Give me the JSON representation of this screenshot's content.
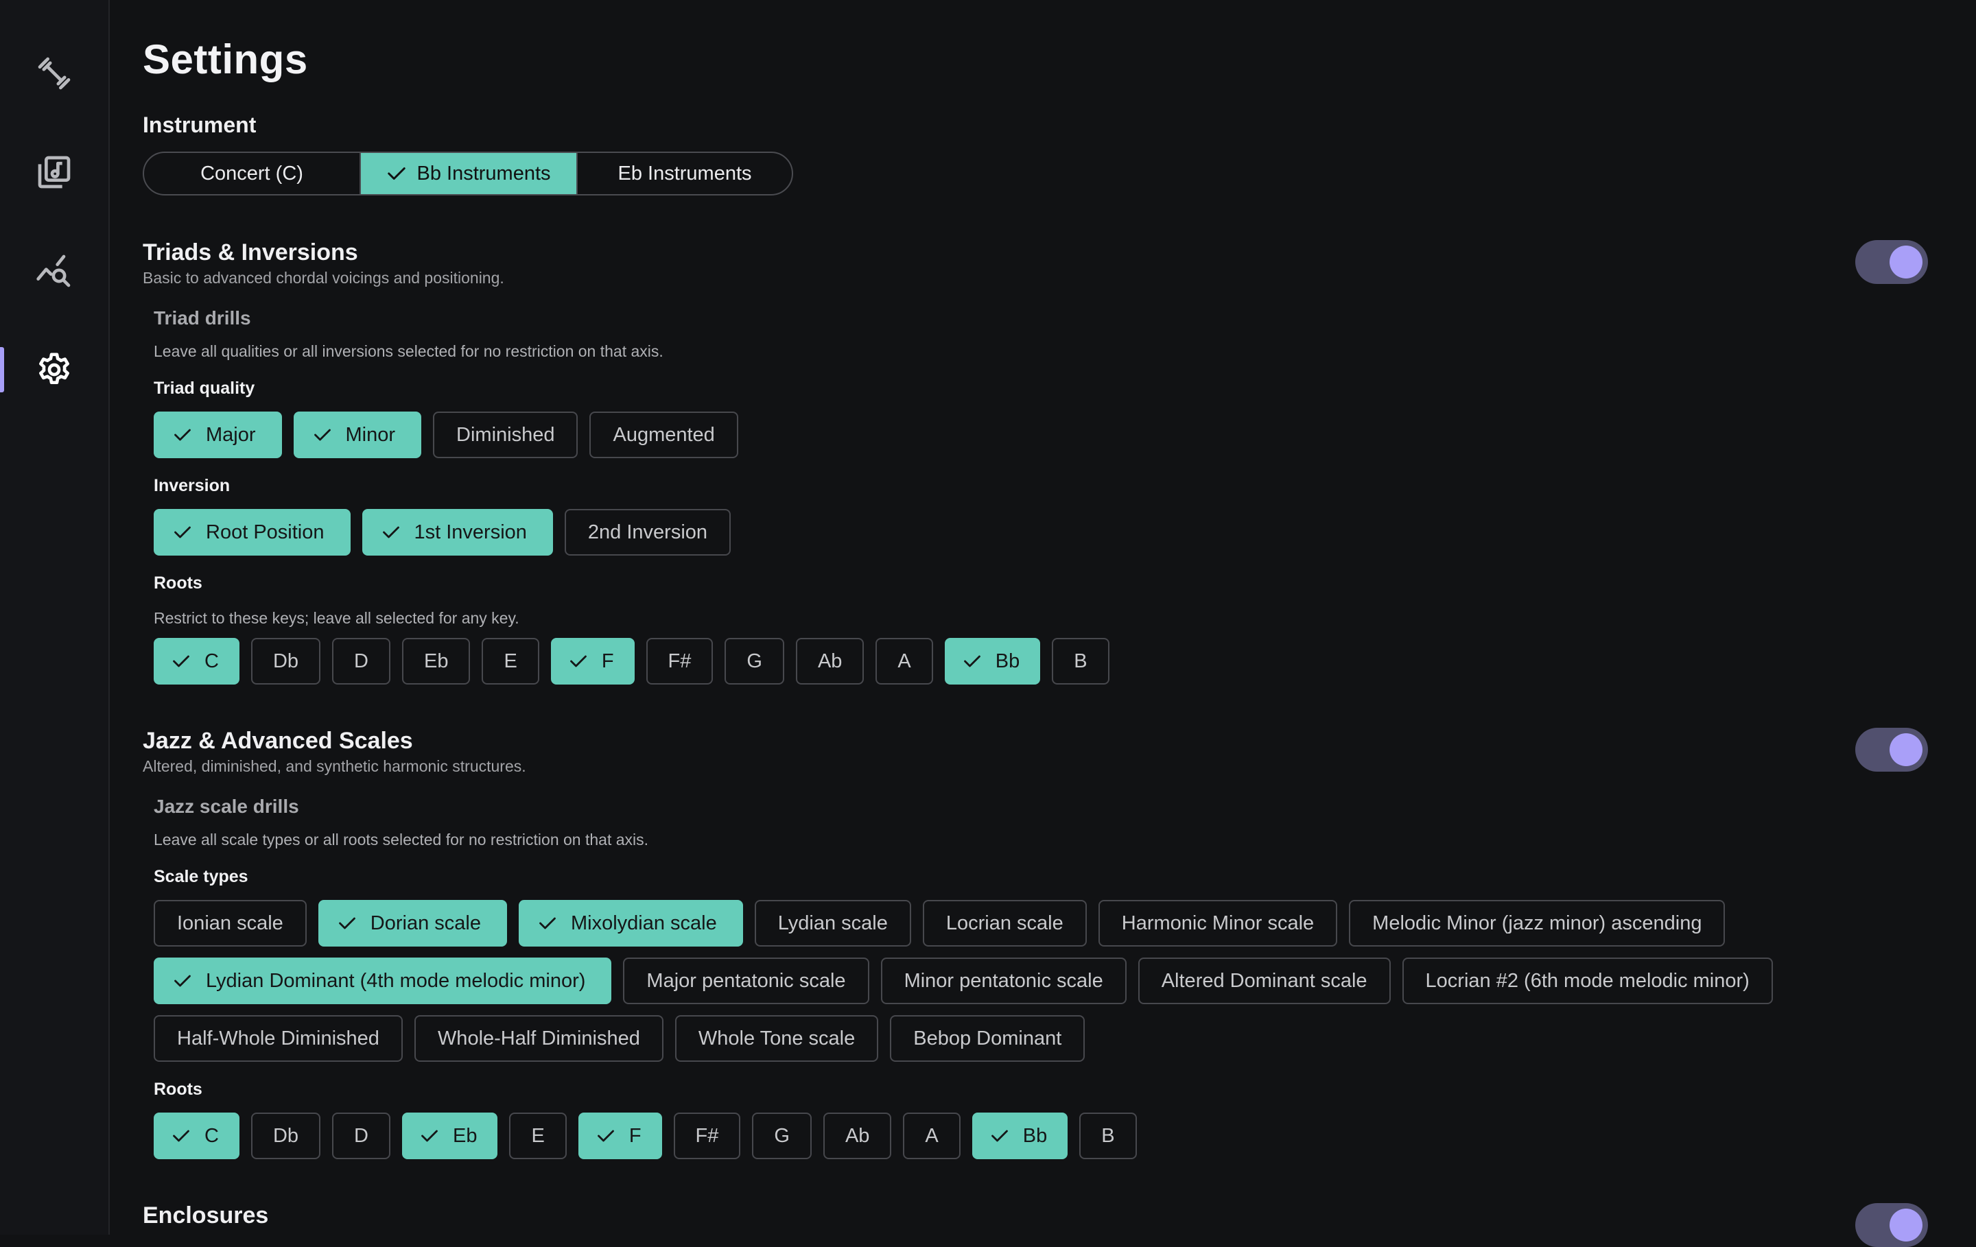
{
  "nav": {
    "items": [
      {
        "name": "practice-nav-item",
        "icon": "dumbbell-icon",
        "active": false
      },
      {
        "name": "library-nav-item",
        "icon": "music-library-icon",
        "active": false
      },
      {
        "name": "stats-nav-item",
        "icon": "analytics-icon",
        "active": false
      },
      {
        "name": "settings-nav-item",
        "icon": "gear-icon",
        "active": true
      }
    ]
  },
  "page": {
    "title": "Settings"
  },
  "instrument": {
    "label": "Instrument",
    "options": [
      {
        "label": "Concert (C)",
        "selected": false
      },
      {
        "label": "Bb Instruments",
        "selected": true
      },
      {
        "label": "Eb Instruments",
        "selected": false
      }
    ]
  },
  "triads": {
    "title": "Triads & Inversions",
    "description": "Basic to advanced chordal voicings and positioning.",
    "enabled": true,
    "drills_title": "Triad drills",
    "drills_desc": "Leave all qualities or all inversions selected for no restriction on that axis.",
    "quality_label": "Triad quality",
    "qualities": [
      {
        "label": "Major",
        "on": true
      },
      {
        "label": "Minor",
        "on": true
      },
      {
        "label": "Diminished",
        "on": false
      },
      {
        "label": "Augmented",
        "on": false
      }
    ],
    "inversion_label": "Inversion",
    "inversions": [
      {
        "label": "Root Position",
        "on": true
      },
      {
        "label": "1st Inversion",
        "on": true
      },
      {
        "label": "2nd Inversion",
        "on": false
      }
    ],
    "roots_label": "Roots",
    "roots_desc": "Restrict to these keys; leave all selected for any key.",
    "roots": [
      {
        "label": "C",
        "on": true
      },
      {
        "label": "Db",
        "on": false
      },
      {
        "label": "D",
        "on": false
      },
      {
        "label": "Eb",
        "on": false
      },
      {
        "label": "E",
        "on": false
      },
      {
        "label": "F",
        "on": true
      },
      {
        "label": "F#",
        "on": false
      },
      {
        "label": "G",
        "on": false
      },
      {
        "label": "Ab",
        "on": false
      },
      {
        "label": "A",
        "on": false
      },
      {
        "label": "Bb",
        "on": true
      },
      {
        "label": "B",
        "on": false
      }
    ]
  },
  "jazz": {
    "title": "Jazz & Advanced Scales",
    "description": "Altered, diminished, and synthetic harmonic structures.",
    "enabled": true,
    "drills_title": "Jazz scale drills",
    "drills_desc": "Leave all scale types or all roots selected for no restriction on that axis.",
    "scale_types_label": "Scale types",
    "scale_rows": [
      [
        {
          "label": "Ionian scale",
          "on": false
        },
        {
          "label": "Dorian scale",
          "on": true
        },
        {
          "label": "Mixolydian scale",
          "on": true
        },
        {
          "label": "Lydian scale",
          "on": false
        },
        {
          "label": "Locrian scale",
          "on": false
        },
        {
          "label": "Harmonic Minor scale",
          "on": false
        },
        {
          "label": "Melodic Minor (jazz minor) ascending",
          "on": false
        }
      ],
      [
        {
          "label": "Lydian Dominant (4th mode melodic minor)",
          "on": true
        },
        {
          "label": "Major pentatonic scale",
          "on": false
        },
        {
          "label": "Minor pentatonic scale",
          "on": false
        },
        {
          "label": "Altered Dominant scale",
          "on": false
        },
        {
          "label": "Locrian #2 (6th mode melodic minor)",
          "on": false
        }
      ],
      [
        {
          "label": "Half-Whole Diminished",
          "on": false
        },
        {
          "label": "Whole-Half Diminished",
          "on": false
        },
        {
          "label": "Whole Tone scale",
          "on": false
        },
        {
          "label": "Bebop Dominant",
          "on": false
        }
      ]
    ],
    "roots_label": "Roots",
    "roots": [
      {
        "label": "C",
        "on": true
      },
      {
        "label": "Db",
        "on": false
      },
      {
        "label": "D",
        "on": false
      },
      {
        "label": "Eb",
        "on": true
      },
      {
        "label": "E",
        "on": false
      },
      {
        "label": "F",
        "on": true
      },
      {
        "label": "F#",
        "on": false
      },
      {
        "label": "G",
        "on": false
      },
      {
        "label": "Ab",
        "on": false
      },
      {
        "label": "A",
        "on": false
      },
      {
        "label": "Bb",
        "on": true
      },
      {
        "label": "B",
        "on": false
      }
    ]
  },
  "enclosures": {
    "title": "Enclosures",
    "enabled": true
  },
  "colors": {
    "accent": "#66cdba",
    "toggle_track": "#51506e",
    "toggle_knob": "#a99ff8",
    "nav_active": "#a79ef7"
  }
}
